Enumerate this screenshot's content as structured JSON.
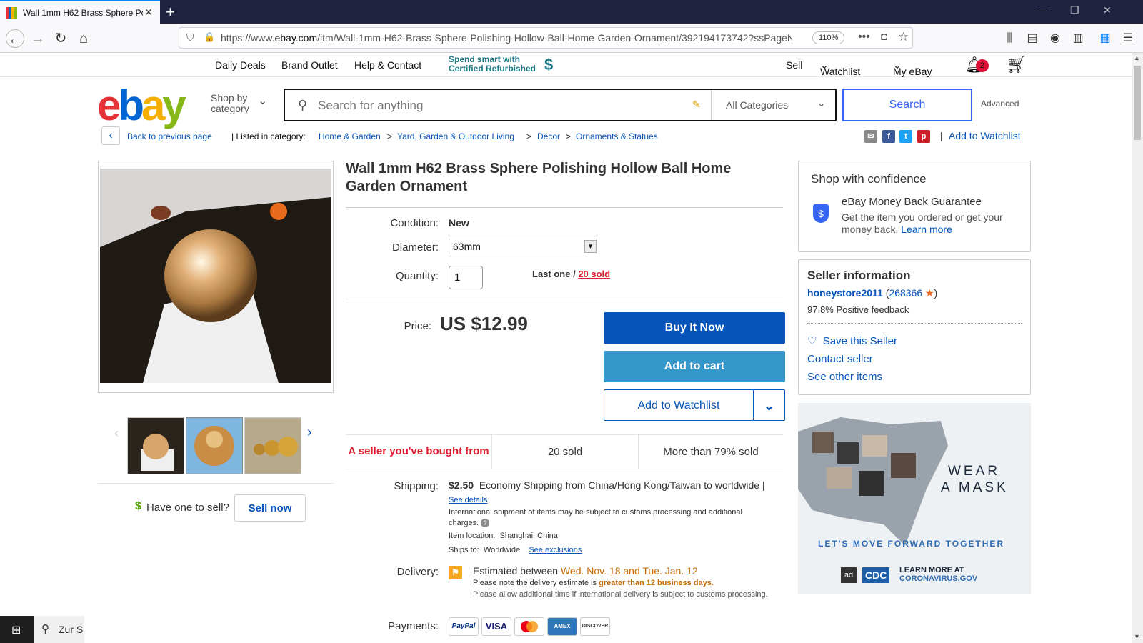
{
  "browser": {
    "tab_title": "Wall 1mm H62 Brass Sphere Po",
    "url_prefix": "https://www.",
    "url_domain": "ebay.com",
    "url_rest": "/itm/Wall-1mm-H62-Brass-Sphere-Polishing-Hollow-Ball-Home-Garden-Ornament/392194173742?ssPageNa",
    "zoom": "110%"
  },
  "topnav": {
    "daily_deals": "Daily Deals",
    "brand_outlet": "Brand Outlet",
    "help": "Help & Contact",
    "promo_line1": "Spend smart with",
    "promo_line2": "Certified Refurbished",
    "sell": "Sell",
    "watchlist": "Watchlist",
    "my_ebay": "My eBay",
    "notification_count": "2"
  },
  "header": {
    "shop_by": "Shop by",
    "category": "category",
    "search_placeholder": "Search for anything",
    "all_categories": "All Categories",
    "search_button": "Search",
    "advanced": "Advanced"
  },
  "breadcrumb": {
    "back": "Back to previous page",
    "listed_in": "Listed in category:",
    "items": [
      "Home & Garden",
      "Yard, Garden & Outdoor Living",
      "Décor",
      "Ornaments & Statues"
    ],
    "add_to_watchlist": "Add to Watchlist"
  },
  "product": {
    "title": "Wall 1mm H62 Brass Sphere Polishing Hollow Ball Home Garden Ornament",
    "condition_label": "Condition:",
    "condition_value": "New",
    "diameter_label": "Diameter:",
    "diameter_value": "63mm",
    "quantity_label": "Quantity:",
    "quantity_value": "1",
    "availability": "Last one /",
    "sold_link": "20 sold",
    "price_label": "Price:",
    "price": "US $12.99",
    "buy_now": "Buy It Now",
    "add_to_cart": "Add to cart",
    "add_to_watchlist": "Add to Watchlist",
    "stats": [
      "A seller you've bought from",
      "20 sold",
      "More than 79% sold"
    ],
    "shipping_label": "Shipping:",
    "shipping_price": "$2.50",
    "shipping_desc": "Economy Shipping from China/Hong Kong/Taiwan to worldwide",
    "see_details": "See details",
    "customs_note": "International shipment of items may be subject to customs processing and additional charges.",
    "item_location_label": "Item location:",
    "item_location": "Shanghai, China",
    "ships_to_label": "Ships to:",
    "ships_to": "Worldwide",
    "see_exclusions": "See exclusions",
    "delivery_label": "Delivery:",
    "delivery_prefix": "Estimated between",
    "delivery_dates": "Wed. Nov. 18 and Tue. Jan. 12",
    "delivery_note_prefix": "Please note the delivery estimate is",
    "delivery_note_bold": "greater than 12 business days.",
    "delivery_note2": "Please allow additional time if international delivery is subject to customs processing.",
    "payments_label": "Payments:",
    "payment_methods": [
      "PayPal",
      "VISA",
      "MC",
      "AMEX",
      "DISCOVER"
    ]
  },
  "sell_prompt": {
    "question": "Have one to sell?",
    "button": "Sell now"
  },
  "confidence": {
    "title": "Shop with confidence",
    "guarantee_title": "eBay Money Back Guarantee",
    "guarantee_text": "Get the item you ordered or get your money back.",
    "learn_more": "Learn more"
  },
  "seller": {
    "heading": "Seller information",
    "name": "honeystore2011",
    "score": "268366",
    "feedback": "97.8% Positive feedback",
    "save": "Save this Seller",
    "contact": "Contact seller",
    "other_items": "See other items"
  },
  "ad": {
    "line1": "WEAR",
    "line2": "A MASK",
    "tagline": "LET'S MOVE FORWARD TOGETHER",
    "ad_label": "ad",
    "cdc": "CDC",
    "learn1": "LEARN MORE AT",
    "learn2": "CORONAVIRUS.GOV"
  },
  "taskbar": {
    "search_text": "Zur S"
  },
  "colors": {
    "ebay_blue": "#0654ba",
    "buy_now": "#0654ba",
    "add_to_cart": "#3498ca",
    "stat_red": "#dd1e31"
  }
}
